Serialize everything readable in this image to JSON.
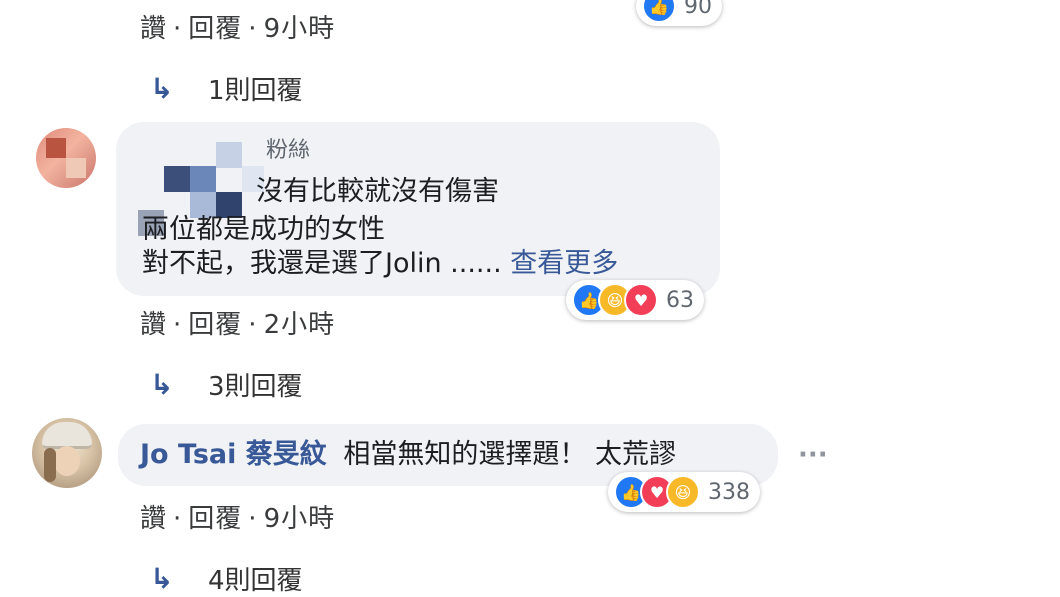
{
  "comments": [
    {
      "actions": {
        "like": "讚",
        "reply": "回覆",
        "time": "9小時"
      },
      "reactions": {
        "count": "90"
      },
      "replies": "1則回覆"
    },
    {
      "author_partial": "粉絲",
      "lines": [
        "沒有比較就沒有傷害",
        "兩位都是成功的女性",
        "對不起，我還是選了Jolin ......"
      ],
      "see_more": "查看更多",
      "actions": {
        "like": "讚",
        "reply": "回覆",
        "time": "2小時"
      },
      "reactions": {
        "count": "63",
        "icons": [
          "like-icon",
          "haha-icon",
          "love-icon"
        ]
      },
      "replies": "3則回覆"
    },
    {
      "author": "Jo Tsai 蔡旻紋",
      "text": "相當無知的選擇題！ 太荒謬",
      "actions": {
        "like": "讚",
        "reply": "回覆",
        "time": "9小時"
      },
      "reactions": {
        "count": "338",
        "icons": [
          "like-icon",
          "love-icon",
          "haha-icon"
        ]
      },
      "replies": "4則回覆"
    }
  ],
  "icons": {
    "reply_arrow": "↳",
    "more": "···"
  },
  "colors": {
    "link": "#385898",
    "like": "#2078f4",
    "love": "#f33e58",
    "haha": "#f7b928",
    "bubble": "#f0f2f5"
  }
}
